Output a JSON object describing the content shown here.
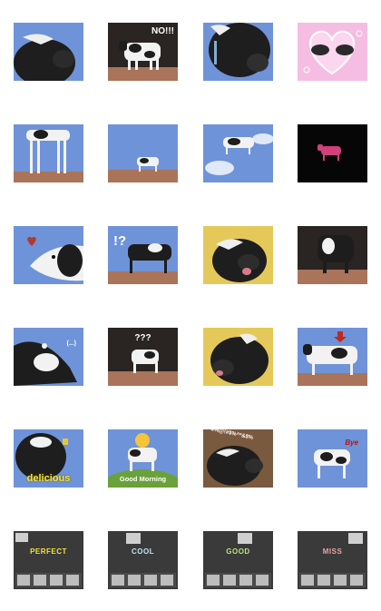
{
  "stickers": [
    {
      "name": "sticker-cow-chewing",
      "bg": "sky",
      "caption": ""
    },
    {
      "name": "sticker-cow-no",
      "bg": "dark",
      "caption": "NO!!!"
    },
    {
      "name": "sticker-cow-crying",
      "bg": "sky",
      "caption": ""
    },
    {
      "name": "sticker-cows-heart",
      "bg": "pink",
      "caption": ""
    },
    {
      "name": "sticker-cow-long-legs",
      "bg": "sky",
      "caption": ""
    },
    {
      "name": "sticker-cow-far",
      "bg": "sky",
      "caption": ""
    },
    {
      "name": "sticker-cow-flying",
      "bg": "sky",
      "caption": ""
    },
    {
      "name": "sticker-cow-pink-dark",
      "bg": "black",
      "caption": ""
    },
    {
      "name": "sticker-cow-love",
      "bg": "sky",
      "caption": ""
    },
    {
      "name": "sticker-cow-question",
      "bg": "sky",
      "caption": "!?"
    },
    {
      "name": "sticker-cow-yellow-lick",
      "bg": "yellow",
      "caption": ""
    },
    {
      "name": "sticker-cow-front",
      "bg": "dark",
      "caption": ""
    },
    {
      "name": "sticker-cow-dots",
      "bg": "sky",
      "caption": "(...)"
    },
    {
      "name": "sticker-cow-confused",
      "bg": "dark",
      "caption": "???"
    },
    {
      "name": "sticker-cow-yellow-tongue",
      "bg": "yellow",
      "caption": ""
    },
    {
      "name": "sticker-cow-arrow",
      "bg": "sky",
      "caption": ""
    },
    {
      "name": "sticker-cow-delicious",
      "bg": "sky",
      "caption": "delicious"
    },
    {
      "name": "sticker-cow-good-morning",
      "bg": "sky",
      "caption": "Good Morning"
    },
    {
      "name": "sticker-cow-swearing",
      "bg": "brown",
      "caption": "$%@!#$%^*&$%"
    },
    {
      "name": "sticker-cow-bye",
      "bg": "sky",
      "caption": "Bye"
    },
    {
      "name": "sticker-perfect",
      "bg": "gray",
      "caption": "PERFECT"
    },
    {
      "name": "sticker-cool",
      "bg": "gray",
      "caption": "COOL"
    },
    {
      "name": "sticker-good",
      "bg": "gray",
      "caption": "GOOD"
    },
    {
      "name": "sticker-miss",
      "bg": "gray",
      "caption": "MISS"
    }
  ],
  "colors": {
    "sky": "#6f93d8",
    "ground": "#a9745a",
    "dark": "#2a2522",
    "black": "#060606",
    "pink": "#f5bde2",
    "yellow": "#e4c95a",
    "brown": "#7a5a3e",
    "gray": "#3a3a3a",
    "cow_black": "#1d1d1d",
    "cow_white": "#f2f2f2",
    "heart": "#b23a2a"
  }
}
